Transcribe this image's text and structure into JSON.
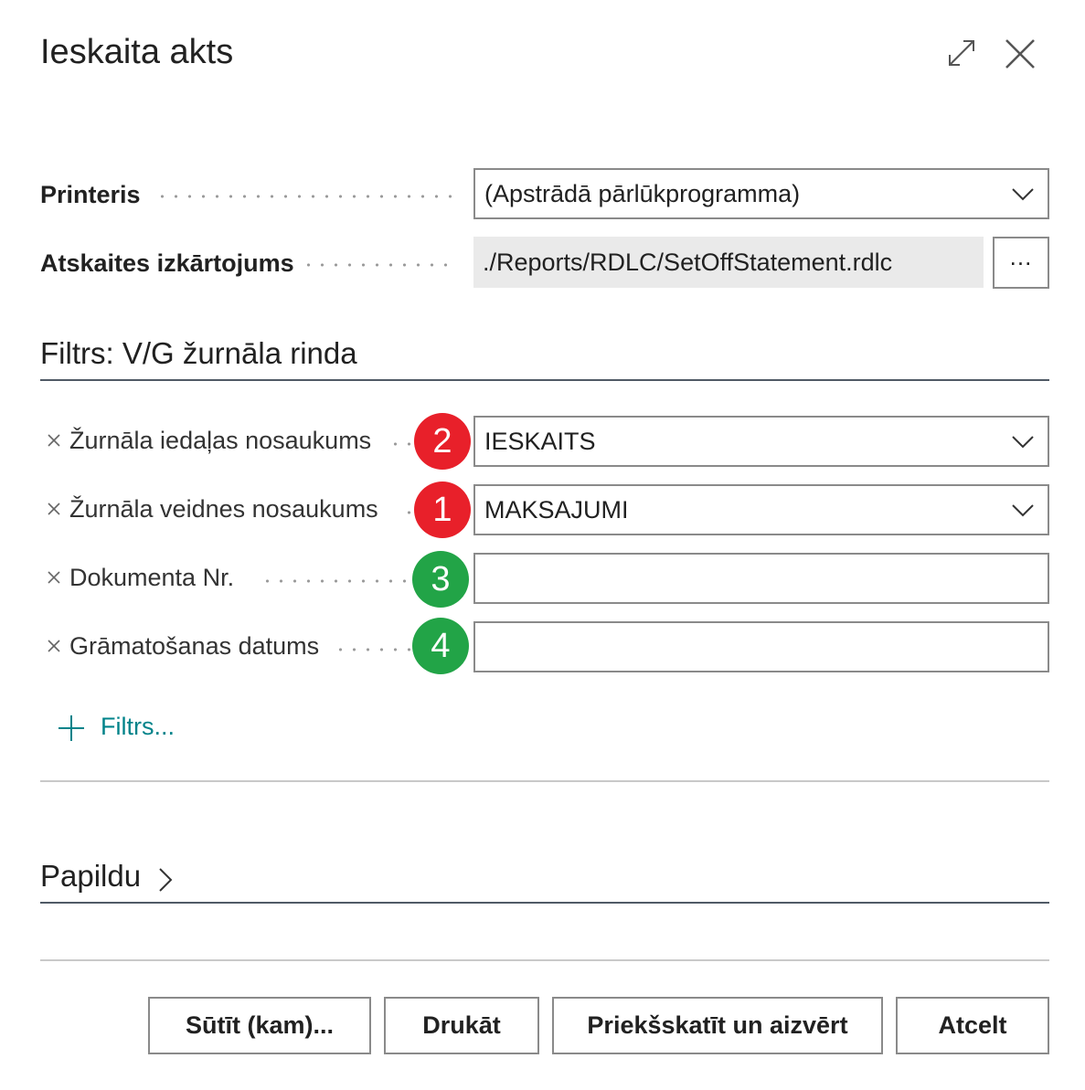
{
  "dialog": {
    "title": "Ieskaita akts"
  },
  "options": {
    "printer_label": "Printeris",
    "printer_value": "(Apstrādā pārlūkprogramma)",
    "layout_label": "Atskaites izkārtojums",
    "layout_value": "./Reports/RDLC/SetOffStatement.rdlc",
    "assist_label": "..."
  },
  "filter_section": {
    "title": "Filtrs: V/G žurnāla rinda",
    "rows": [
      {
        "label": "Žurnāla iedaļas nosaukums",
        "value": "IESKAITS",
        "badge": "2",
        "badge_color": "#e8202a"
      },
      {
        "label": "Žurnāla veidnes nosaukums",
        "value": "MAKSAJUMI",
        "badge": "1",
        "badge_color": "#e8202a"
      },
      {
        "label": "Dokumenta Nr.",
        "value": "",
        "badge": "3",
        "badge_color": "#22a447"
      },
      {
        "label": "Grāmatošanas datums",
        "value": "",
        "badge": "4",
        "badge_color": "#22a447"
      }
    ],
    "add_filter_label": "Filtrs..."
  },
  "more_section": {
    "title": "Papildu"
  },
  "buttons": {
    "send_to": "Sūtīt (kam)...",
    "print": "Drukāt",
    "preview_close": "Priekšskatīt un aizvērt",
    "cancel": "Atcelt"
  },
  "colors": {
    "accent": "#00838a",
    "badge_red": "#e8202a",
    "badge_green": "#22a447"
  }
}
